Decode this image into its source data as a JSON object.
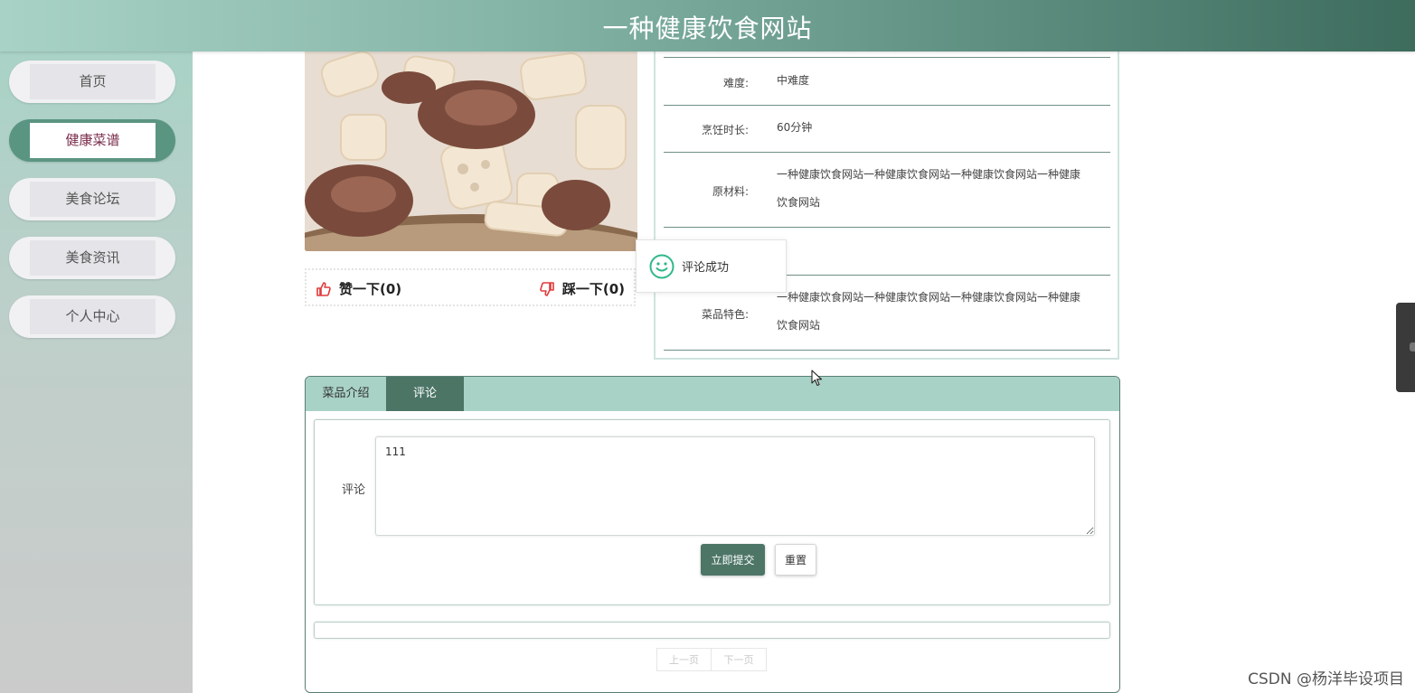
{
  "header": {
    "title": "一种健康饮食网站"
  },
  "sidebar": {
    "items": [
      {
        "label": "首页",
        "active": false
      },
      {
        "label": "健康菜谱",
        "active": true
      },
      {
        "label": "美食论坛",
        "active": false
      },
      {
        "label": "美食资讯",
        "active": false
      },
      {
        "label": "个人中心",
        "active": false
      }
    ]
  },
  "vote": {
    "like_label": "赞一下(0)",
    "dislike_label": "踩一下(0)"
  },
  "info": {
    "difficulty_label": "难度:",
    "difficulty_value": "中难度",
    "duration_label": "烹饪时长:",
    "duration_value": "60分钟",
    "ingredients_label": "原材料:",
    "ingredients_value": "一种健康饮食网站一种健康饮食网站一种健康饮食网站一种健康饮食网站",
    "features_label": "菜品特色:",
    "features_value": "一种健康饮食网站一种健康饮食网站一种健康饮食网站一种健康饮食网站"
  },
  "toast": {
    "message": "评论成功"
  },
  "tabs": {
    "intro": "菜品介绍",
    "comment": "评论"
  },
  "comment_form": {
    "label": "评论",
    "value": "111",
    "submit_label": "立即提交",
    "reset_label": "重置"
  },
  "pager": {
    "prev": "上一页",
    "next": "下一页"
  },
  "watermark": "CSDN @杨洋毕设项目",
  "colors": {
    "accent": "#4d7667",
    "tab_strip": "#a8d2c6",
    "active_nav": "#5a9582",
    "like_icon": "#e03a3a"
  }
}
